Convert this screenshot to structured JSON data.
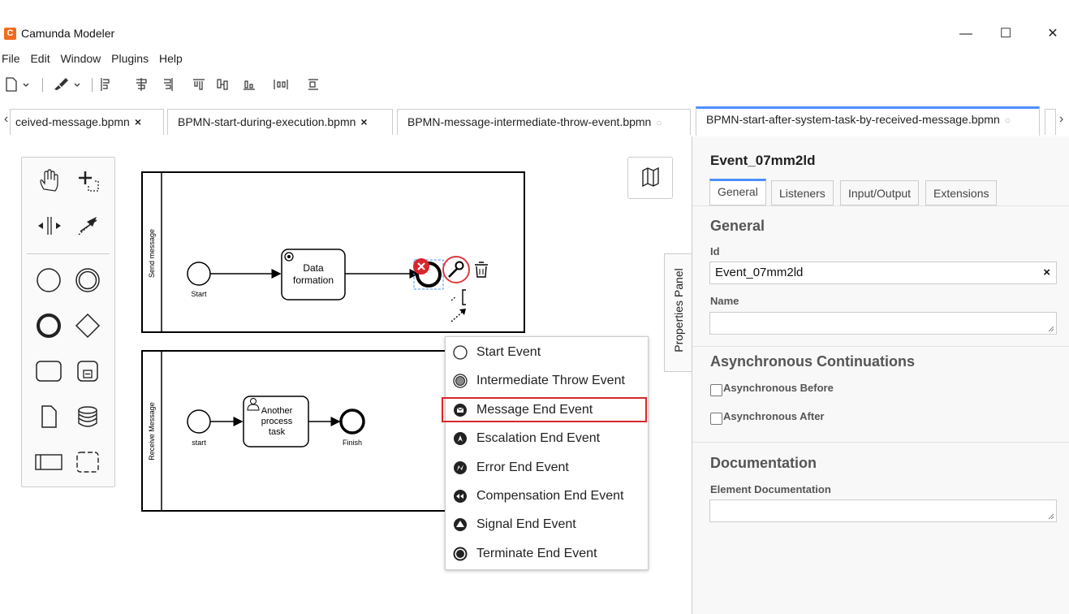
{
  "window": {
    "title": "Camunda Modeler",
    "logo_letter": "C",
    "minimize": "—",
    "maximize": "☐",
    "close": "✕"
  },
  "menu": [
    "File",
    "Edit",
    "Window",
    "Plugins",
    "Help"
  ],
  "tabs": {
    "scroll_left": "‹",
    "scroll_right": "›",
    "items": [
      {
        "label": "ceived-message.bpmn",
        "mark": "×"
      },
      {
        "label": "BPMN-start-during-execution.bpmn",
        "mark": "×"
      },
      {
        "label": "BPMN-message-intermediate-throw-event.bpmn",
        "mark": "○"
      },
      {
        "label": "BPMN-start-after-system-task-by-received-message.bpmn",
        "mark": "○"
      }
    ]
  },
  "diagram": {
    "pool1_label": "Send message",
    "pool2_label": "Receive Message",
    "start1_label": "Start",
    "task1_label_line1": "Data",
    "task1_label_line2": "formation",
    "start2_label": "start",
    "task2_label_line1": "Another",
    "task2_label_line2": "process",
    "task2_label_line3": "task",
    "end2_label": "Finish"
  },
  "properties_toggle": "Properties Panel",
  "properties": {
    "element_id_title": "Event_07mm2ld",
    "tabs": [
      "General",
      "Listeners",
      "Input/Output",
      "Extensions"
    ],
    "general_heading": "General",
    "id_label": "Id",
    "id_value": "Event_07mm2ld",
    "clear_icon": "×",
    "name_label": "Name",
    "name_value": "",
    "async_heading": "Asynchronous Continuations",
    "async_before": "Asynchronous Before",
    "async_after": "Asynchronous After",
    "doc_heading": "Documentation",
    "doc_label": "Element Documentation",
    "doc_value": ""
  },
  "replace_menu": {
    "items": [
      {
        "label": "Start Event",
        "icon": "start-event-icon"
      },
      {
        "label": "Intermediate Throw Event",
        "icon": "intermediate-throw-event-icon"
      },
      {
        "label": "Message End Event",
        "icon": "message-end-event-icon"
      },
      {
        "label": "Escalation End Event",
        "icon": "escalation-end-event-icon"
      },
      {
        "label": "Error End Event",
        "icon": "error-end-event-icon"
      },
      {
        "label": "Compensation End Event",
        "icon": "compensation-end-event-icon"
      },
      {
        "label": "Signal End Event",
        "icon": "signal-end-event-icon"
      },
      {
        "label": "Terminate End Event",
        "icon": "terminate-end-event-icon"
      }
    ],
    "highlighted": "Message End Event"
  },
  "colors": {
    "accent": "#4d90fe",
    "highlight_border": "#d9262d",
    "selection_red": "#d9262d",
    "app_logo": "#f26a1b"
  }
}
